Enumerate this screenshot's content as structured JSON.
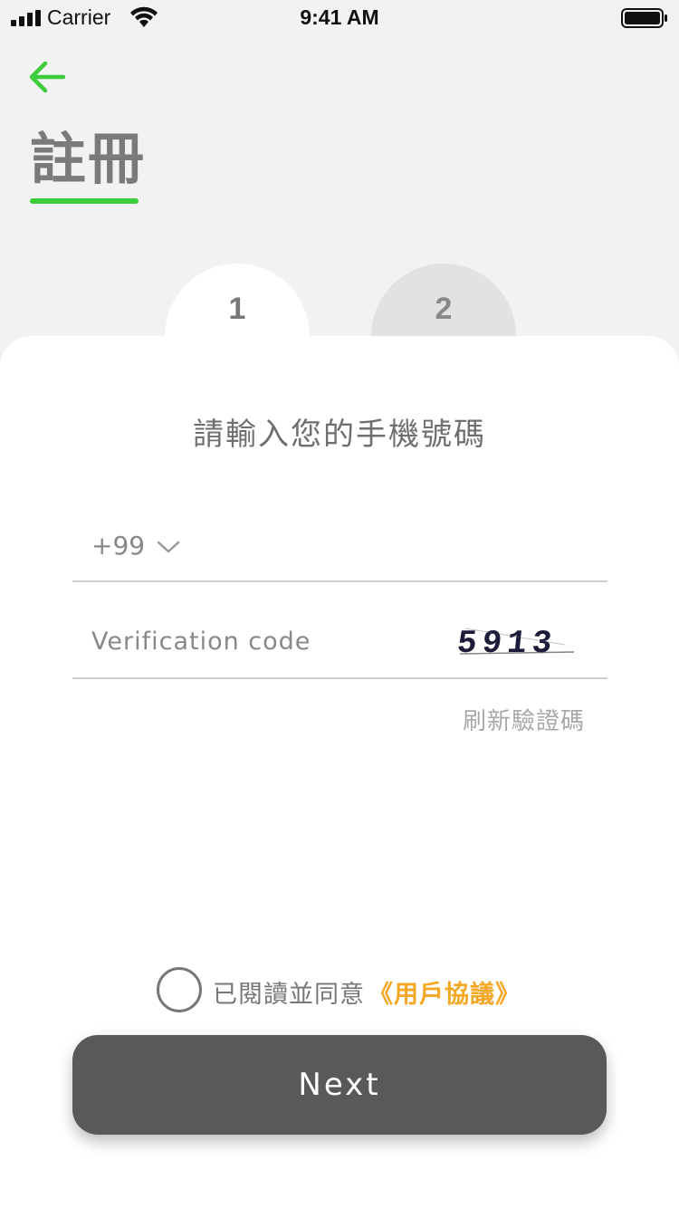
{
  "status_bar": {
    "carrier": "Carrier",
    "time": "9:41 AM",
    "signal_icon": "signal-bars-icon",
    "wifi_icon": "wifi-icon",
    "battery_icon": "battery-icon"
  },
  "header": {
    "back_icon": "arrow-left-icon",
    "title": "註冊",
    "accent_color": "#3ccc3c"
  },
  "steps": [
    {
      "label": "1",
      "active": true
    },
    {
      "label": "2",
      "active": false
    }
  ],
  "form": {
    "heading": "請輸入您的手機號碼",
    "country_code": "+99",
    "chevron_icon": "chevron-down-icon",
    "verification_placeholder": "Verification code",
    "verification_value": "",
    "captcha_text": "5913",
    "refresh_label": "刷新驗證碼"
  },
  "agreement": {
    "checked": false,
    "text": "已閱讀並同意",
    "link_text": "《用戶協議》",
    "link_color": "#f5a623"
  },
  "next_button": {
    "label": "Next",
    "color": "#595959"
  }
}
